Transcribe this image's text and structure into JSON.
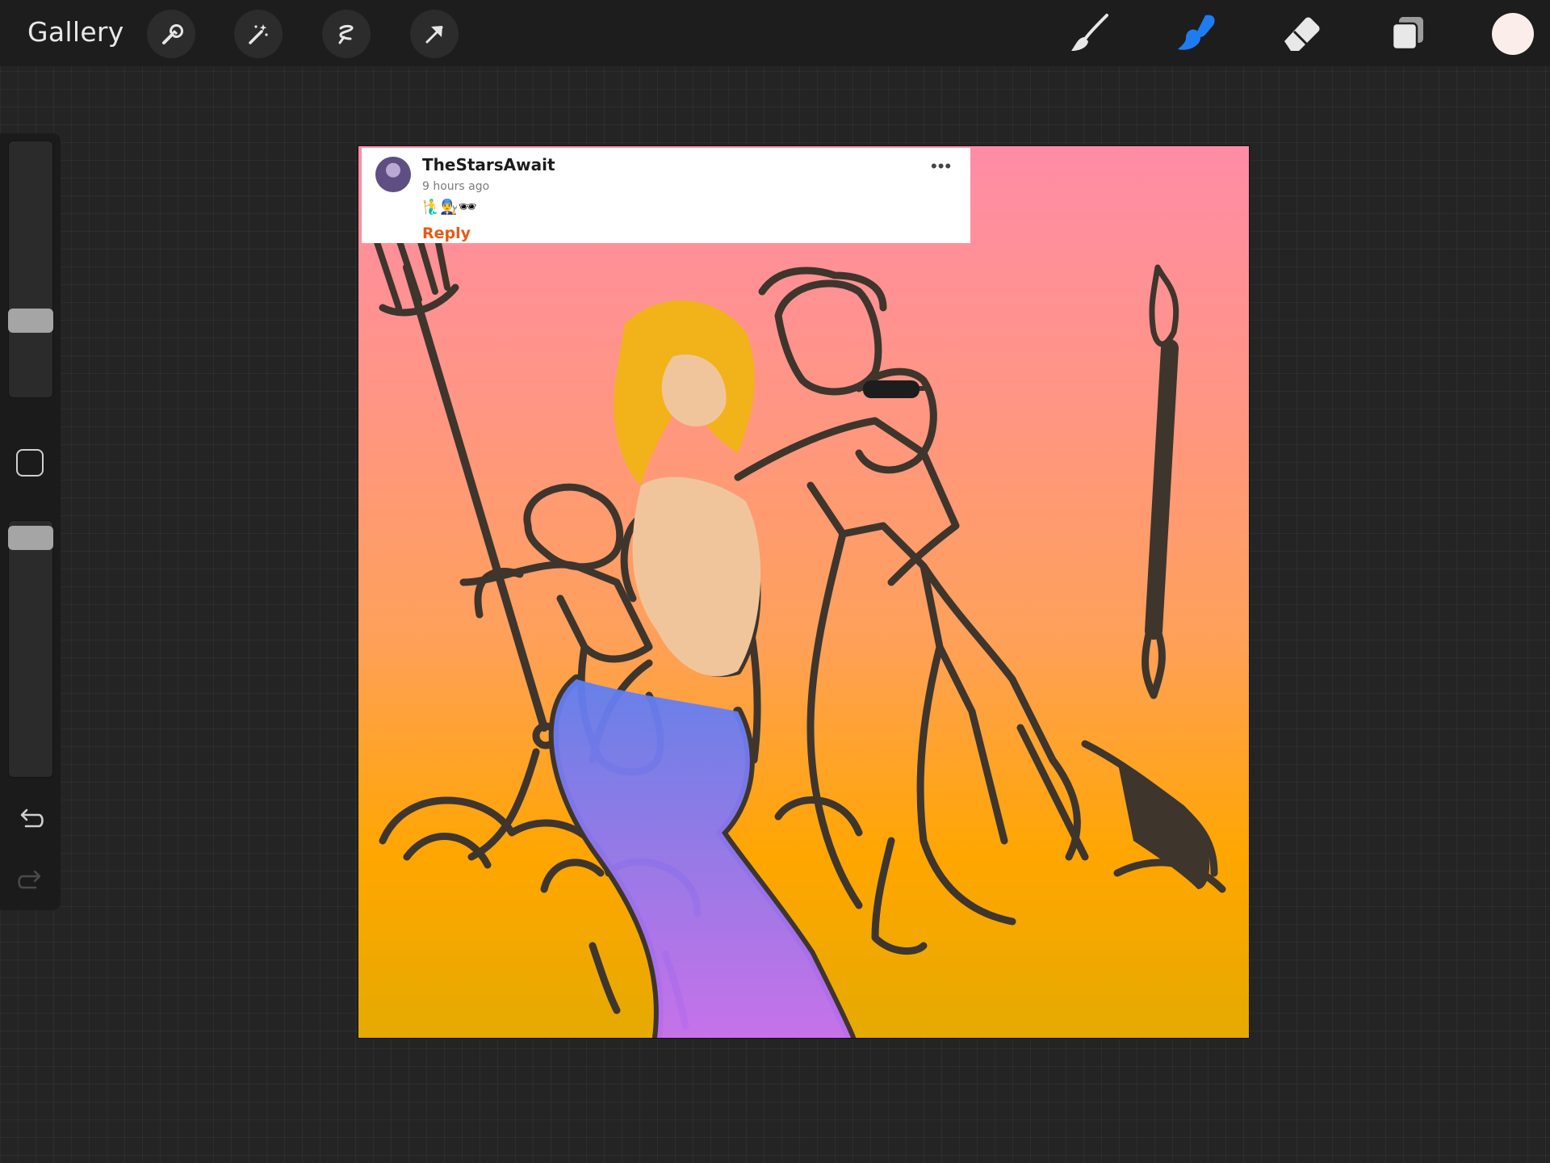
{
  "toolbar": {
    "gallery_label": "Gallery",
    "left_tools": [
      "wrench-icon",
      "magic-wand-icon",
      "selection-icon",
      "transform-arrow-icon"
    ],
    "right_tools": [
      "brush-icon",
      "smudge-icon",
      "eraser-icon",
      "layers-icon"
    ],
    "active_tool": "smudge-icon",
    "active_color": "#1f7cf0",
    "current_color": "#fbeeea"
  },
  "sidebar": {
    "brush_size_level": 0.71,
    "opacity_level": 0.95
  },
  "canvas": {
    "comment": {
      "username": "TheStarsAwait",
      "timestamp": "9 hours ago",
      "emojis": "🧜‍♂️👨‍🔧🕶",
      "reply_label": "Reply",
      "more_label": "•••"
    }
  },
  "colors": {
    "ink": "#3e352d",
    "hair": "#f1b319",
    "skin": "#f1c59c",
    "tail_top": "#5f7ff0",
    "tail_bottom": "#c56ff5"
  }
}
